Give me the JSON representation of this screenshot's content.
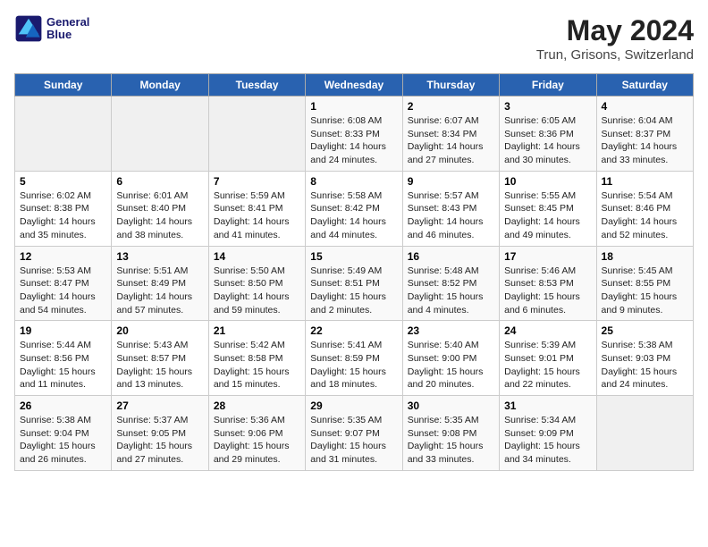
{
  "header": {
    "logo_line1": "General",
    "logo_line2": "Blue",
    "title": "May 2024",
    "subtitle": "Trun, Grisons, Switzerland"
  },
  "weekdays": [
    "Sunday",
    "Monday",
    "Tuesday",
    "Wednesday",
    "Thursday",
    "Friday",
    "Saturday"
  ],
  "weeks": [
    [
      {
        "day": "",
        "empty": true
      },
      {
        "day": "",
        "empty": true
      },
      {
        "day": "",
        "empty": true
      },
      {
        "day": "1",
        "sunrise": "6:08 AM",
        "sunset": "8:33 PM",
        "daylight": "14 hours and 24 minutes."
      },
      {
        "day": "2",
        "sunrise": "6:07 AM",
        "sunset": "8:34 PM",
        "daylight": "14 hours and 27 minutes."
      },
      {
        "day": "3",
        "sunrise": "6:05 AM",
        "sunset": "8:36 PM",
        "daylight": "14 hours and 30 minutes."
      },
      {
        "day": "4",
        "sunrise": "6:04 AM",
        "sunset": "8:37 PM",
        "daylight": "14 hours and 33 minutes."
      }
    ],
    [
      {
        "day": "5",
        "sunrise": "6:02 AM",
        "sunset": "8:38 PM",
        "daylight": "14 hours and 35 minutes."
      },
      {
        "day": "6",
        "sunrise": "6:01 AM",
        "sunset": "8:40 PM",
        "daylight": "14 hours and 38 minutes."
      },
      {
        "day": "7",
        "sunrise": "5:59 AM",
        "sunset": "8:41 PM",
        "daylight": "14 hours and 41 minutes."
      },
      {
        "day": "8",
        "sunrise": "5:58 AM",
        "sunset": "8:42 PM",
        "daylight": "14 hours and 44 minutes."
      },
      {
        "day": "9",
        "sunrise": "5:57 AM",
        "sunset": "8:43 PM",
        "daylight": "14 hours and 46 minutes."
      },
      {
        "day": "10",
        "sunrise": "5:55 AM",
        "sunset": "8:45 PM",
        "daylight": "14 hours and 49 minutes."
      },
      {
        "day": "11",
        "sunrise": "5:54 AM",
        "sunset": "8:46 PM",
        "daylight": "14 hours and 52 minutes."
      }
    ],
    [
      {
        "day": "12",
        "sunrise": "5:53 AM",
        "sunset": "8:47 PM",
        "daylight": "14 hours and 54 minutes."
      },
      {
        "day": "13",
        "sunrise": "5:51 AM",
        "sunset": "8:49 PM",
        "daylight": "14 hours and 57 minutes."
      },
      {
        "day": "14",
        "sunrise": "5:50 AM",
        "sunset": "8:50 PM",
        "daylight": "14 hours and 59 minutes."
      },
      {
        "day": "15",
        "sunrise": "5:49 AM",
        "sunset": "8:51 PM",
        "daylight": "15 hours and 2 minutes."
      },
      {
        "day": "16",
        "sunrise": "5:48 AM",
        "sunset": "8:52 PM",
        "daylight": "15 hours and 4 minutes."
      },
      {
        "day": "17",
        "sunrise": "5:46 AM",
        "sunset": "8:53 PM",
        "daylight": "15 hours and 6 minutes."
      },
      {
        "day": "18",
        "sunrise": "5:45 AM",
        "sunset": "8:55 PM",
        "daylight": "15 hours and 9 minutes."
      }
    ],
    [
      {
        "day": "19",
        "sunrise": "5:44 AM",
        "sunset": "8:56 PM",
        "daylight": "15 hours and 11 minutes."
      },
      {
        "day": "20",
        "sunrise": "5:43 AM",
        "sunset": "8:57 PM",
        "daylight": "15 hours and 13 minutes."
      },
      {
        "day": "21",
        "sunrise": "5:42 AM",
        "sunset": "8:58 PM",
        "daylight": "15 hours and 15 minutes."
      },
      {
        "day": "22",
        "sunrise": "5:41 AM",
        "sunset": "8:59 PM",
        "daylight": "15 hours and 18 minutes."
      },
      {
        "day": "23",
        "sunrise": "5:40 AM",
        "sunset": "9:00 PM",
        "daylight": "15 hours and 20 minutes."
      },
      {
        "day": "24",
        "sunrise": "5:39 AM",
        "sunset": "9:01 PM",
        "daylight": "15 hours and 22 minutes."
      },
      {
        "day": "25",
        "sunrise": "5:38 AM",
        "sunset": "9:03 PM",
        "daylight": "15 hours and 24 minutes."
      }
    ],
    [
      {
        "day": "26",
        "sunrise": "5:38 AM",
        "sunset": "9:04 PM",
        "daylight": "15 hours and 26 minutes."
      },
      {
        "day": "27",
        "sunrise": "5:37 AM",
        "sunset": "9:05 PM",
        "daylight": "15 hours and 27 minutes."
      },
      {
        "day": "28",
        "sunrise": "5:36 AM",
        "sunset": "9:06 PM",
        "daylight": "15 hours and 29 minutes."
      },
      {
        "day": "29",
        "sunrise": "5:35 AM",
        "sunset": "9:07 PM",
        "daylight": "15 hours and 31 minutes."
      },
      {
        "day": "30",
        "sunrise": "5:35 AM",
        "sunset": "9:08 PM",
        "daylight": "15 hours and 33 minutes."
      },
      {
        "day": "31",
        "sunrise": "5:34 AM",
        "sunset": "9:09 PM",
        "daylight": "15 hours and 34 minutes."
      },
      {
        "day": "",
        "empty": true
      }
    ]
  ]
}
